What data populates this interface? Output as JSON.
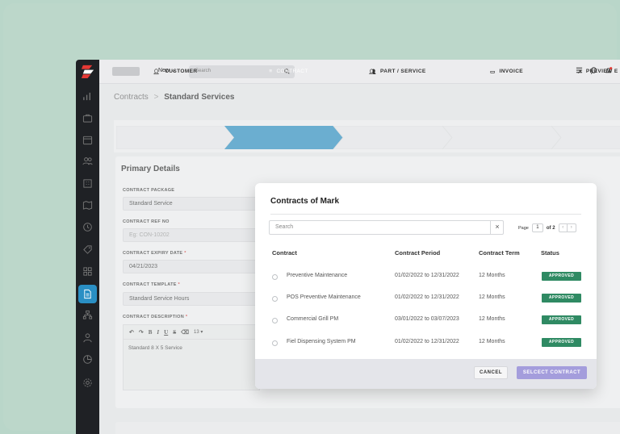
{
  "topbar": {
    "new_label": "New ⌄",
    "search_placeholder": "Search"
  },
  "breadcrumb": {
    "parent": "Contracts",
    "separator": ">",
    "current": "Standard Services"
  },
  "steps": [
    {
      "label": "CUSTOMER",
      "icon": "user-icon",
      "active": false
    },
    {
      "label": "CONTRACT",
      "icon": "document-icon",
      "active": true
    },
    {
      "label": "PART / SERVICE",
      "icon": "users-icon",
      "active": false
    },
    {
      "label": "INVOICE",
      "icon": "folder-icon",
      "active": false
    },
    {
      "label": "PREVIEW E",
      "icon": "arrow-icon",
      "active": false
    }
  ],
  "colors": {
    "accent": "#2a8fc4",
    "approved": "#2f8a63",
    "primary_button": "#a49ddc",
    "required": "#d32f2f"
  },
  "form": {
    "title": "Primary Details",
    "contract_package": {
      "label": "CONTRACT PACKAGE",
      "value": "Standard Service"
    },
    "contract_ref": {
      "label": "CONTRACT REF NO",
      "placeholder": "Eg: CON-10202"
    },
    "expiry": {
      "label": "CONTRACT EXPIRY DATE",
      "value": "04/21/2023"
    },
    "template": {
      "label": "CONTRACT TEMPLATE",
      "value": "Standard Service Hours"
    },
    "description": {
      "label": "CONTRACT DESCRIPTION",
      "value": "Standard 8 X 5 Service",
      "font_size": "13"
    }
  },
  "modal": {
    "title": "Contracts of Mark",
    "search_placeholder": "Search",
    "clear": "×",
    "page_label": "Page",
    "page_current": "1",
    "page_total": "of 2",
    "columns": [
      "Contract",
      "Contract Period",
      "Contract Term",
      "Status"
    ],
    "rows": [
      {
        "name": "Preventive Maintenance",
        "period": "01/02/2022 to 12/31/2022",
        "term": "12 Months",
        "status": "APPROVED"
      },
      {
        "name": "POS Preventive Maintenance",
        "period": "01/02/2022 to 12/31/2022",
        "term": "12 Months",
        "status": "APPROVED"
      },
      {
        "name": "Commercial Grill PM",
        "period": "03/01/2022 to 03/07/2023",
        "term": "12 Months",
        "status": "APPROVED"
      },
      {
        "name": "Fiel Dispensing System PM",
        "period": "01/02/2022 to 12/31/2022",
        "term": "12 Months",
        "status": "APPROVED"
      }
    ],
    "cancel_label": "CANCEL",
    "select_label": "SELCECT CONTRACT"
  }
}
